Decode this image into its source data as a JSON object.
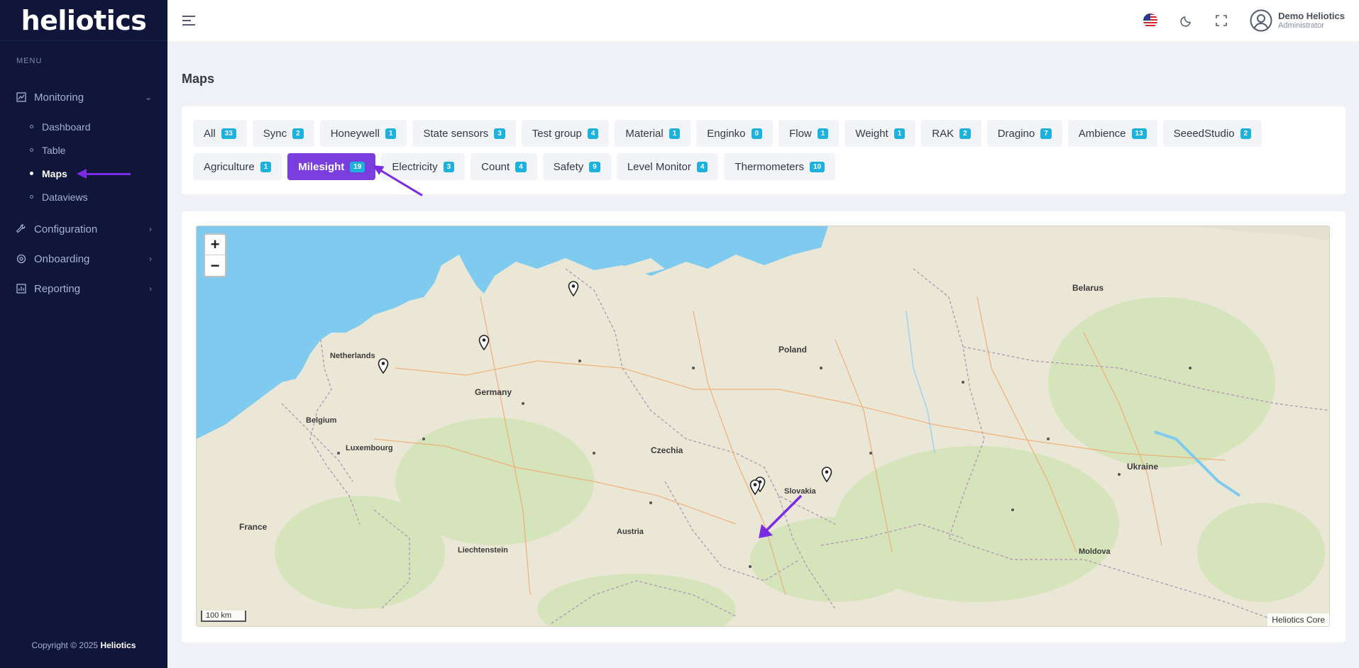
{
  "app": {
    "logo_text": "heliotics"
  },
  "sidebar": {
    "menu_title": "MENU",
    "monitoring": {
      "label": "Monitoring"
    },
    "monitoring_items": [
      {
        "label": "Dashboard"
      },
      {
        "label": "Table"
      },
      {
        "label": "Maps"
      },
      {
        "label": "Dataviews"
      }
    ],
    "configuration": {
      "label": "Configuration"
    },
    "onboarding": {
      "label": "Onboarding"
    },
    "reporting": {
      "label": "Reporting"
    },
    "copyright_prefix": "Copyright © 2025 ",
    "copyright_brand": "Heliotics"
  },
  "topbar": {
    "user_name": "Demo Heliotics",
    "user_role": "Administrator",
    "icons": [
      "menu-icon",
      "us-flag-icon",
      "moon-icon",
      "fullscreen-icon",
      "user-avatar-icon"
    ]
  },
  "page": {
    "title": "Maps"
  },
  "tags_row1": [
    {
      "label": "All",
      "count": "33"
    },
    {
      "label": "Sync",
      "count": "2"
    },
    {
      "label": "Honeywell",
      "count": "1"
    },
    {
      "label": "State sensors",
      "count": "3"
    },
    {
      "label": "Test group",
      "count": "4"
    },
    {
      "label": "Material",
      "count": "1"
    },
    {
      "label": "Enginko",
      "count": "0"
    },
    {
      "label": "Flow",
      "count": "1"
    },
    {
      "label": "Weight",
      "count": "1"
    },
    {
      "label": "RAK",
      "count": "2"
    },
    {
      "label": "Dragino",
      "count": "7"
    },
    {
      "label": "Ambience",
      "count": "13"
    },
    {
      "label": "SeeedStudio",
      "count": "2"
    }
  ],
  "tags_row2": [
    {
      "label": "Agriculture",
      "count": "1"
    },
    {
      "label": "Milesight",
      "count": "19"
    },
    {
      "label": "Electricity",
      "count": "3"
    },
    {
      "label": "Count",
      "count": "4"
    },
    {
      "label": "Safety",
      "count": "9"
    },
    {
      "label": "Level Monitor",
      "count": "4"
    },
    {
      "label": "Thermometers",
      "count": "10"
    }
  ],
  "active_tag": "Milesight",
  "map": {
    "zoom_in": "+",
    "zoom_out": "−",
    "scale": "100 km",
    "attribution": "Heliotics Core",
    "labels": {
      "belarus": "Belarus",
      "poland": "Poland",
      "netherlands": "Netherlands",
      "germany": "Germany",
      "belgium": "Belgium",
      "luxembourg": "Luxembourg",
      "czechia": "Czechia",
      "slovakia": "Slovakia",
      "ukraine": "Ukraine",
      "france": "France",
      "austria": "Austria",
      "liechtenstein": "Liechtenstein",
      "moldova": "Moldova"
    }
  },
  "colors": {
    "sidebar_bg": "#10163a",
    "accent_purple": "#7a3ede",
    "badge_blue": "#1cb2dd",
    "sea": "#7ecbef"
  }
}
